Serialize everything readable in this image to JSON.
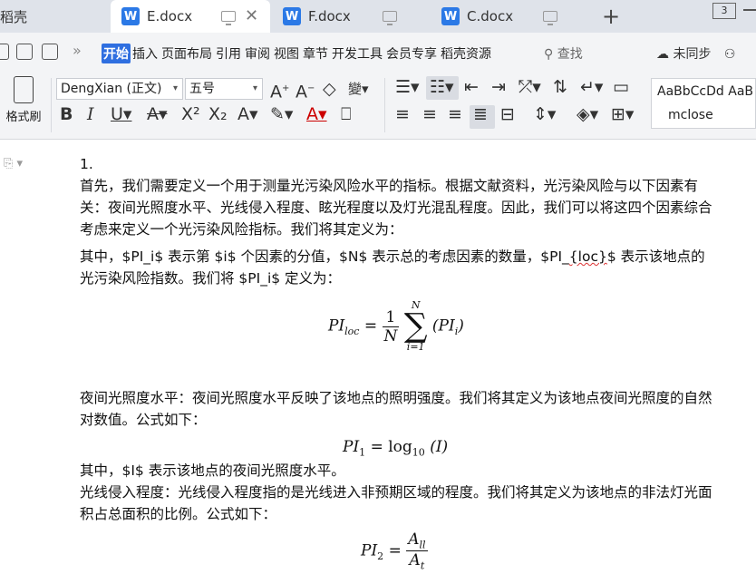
{
  "tabs": {
    "home_label": "稻壳",
    "items": [
      {
        "label": "E.docx",
        "icon": "W"
      },
      {
        "label": "F.docx",
        "icon": "W"
      },
      {
        "label": "C.docx",
        "icon": "W"
      }
    ],
    "badge": "3"
  },
  "menu": {
    "items": [
      "开始",
      "插入",
      "页面布局",
      "引用",
      "审阅",
      "视图",
      "章节",
      "开发工具",
      "会员专享",
      "稻壳资源"
    ],
    "search": "查找",
    "sync": "未同步"
  },
  "ribbon": {
    "format_painter": "格式刷",
    "font_name": "DengXian (正文)",
    "font_size": "五号",
    "style_sample": "AaBbCcDd AaB",
    "style_name": "mclose"
  },
  "document": {
    "para1": "1.",
    "para2": "首先，我们需要定义一个用于测量光污染风险水平的指标。根据文献资料，光污染风险与以下因素有关：夜间光照度水平、光线侵入程度、眩光程度以及灯光混乱程度。因此，我们可以将这四个因素综合考虑来定义一个光污染风险指标。我们将其定义为：",
    "para3a": "其中，$PI_i$ 表示第 $i$ 个因素的分值，$N$ 表示总的考虑因素的数量，$PI_",
    "para3b": "{loc}",
    "para3c": "$ 表示该地点的光污染风险指数。我们将 $PI_i$ 定义为：",
    "para4": "夜间光照度水平：夜间光照度水平反映了该地点的照明强度。我们将其定义为该地点夜间光照度的自然对数值。公式如下：",
    "para5": "其中，$I$ 表示该地点的夜间光照度水平。",
    "para6": "光线侵入程度：光线侵入程度指的是光线进入非预期区域的程度。我们将其定义为该地点的非法灯光面积占总面积的比例。公式如下："
  },
  "formulas": {
    "f1_lhs": "PI",
    "f1_lhs_sub": "loc",
    "f1_num": "1",
    "f1_den": "N",
    "f1_sum_top": "N",
    "f1_sum_bottom": "i=1",
    "f1_term": "(PI",
    "f1_term_sub": "i",
    "f2_lhs": "PI",
    "f2_lhs_sub": "1",
    "f2_fn": "log",
    "f2_fn_sub": "10",
    "f2_arg": "(I)",
    "f3_lhs": "PI",
    "f3_lhs_sub": "2",
    "f3_num": "A",
    "f3_num_sub": "ll",
    "f3_den": "A",
    "f3_den_sub": "t"
  },
  "colors": {
    "accent": "#2f6fe0",
    "doc_icon": "#2b79e6",
    "tab_bar": "#dfe3ea"
  }
}
